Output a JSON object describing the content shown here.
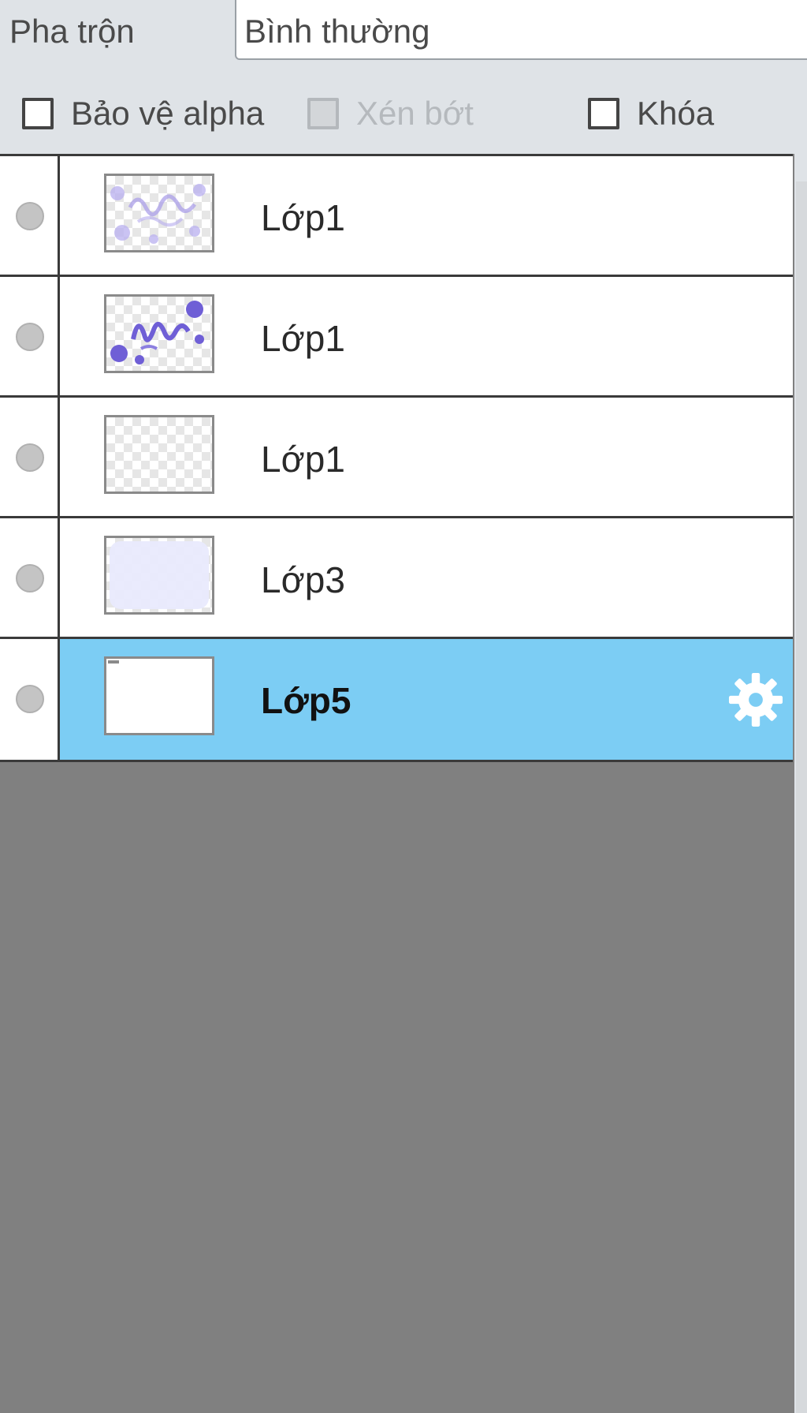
{
  "blend": {
    "label": "Pha trộn",
    "value": "Bình thường"
  },
  "options": {
    "alpha_protect": {
      "label": "Bảo vệ alpha",
      "checked": false,
      "enabled": true
    },
    "clipping": {
      "label": "Xén bớt",
      "checked": false,
      "enabled": false
    },
    "lock": {
      "label": "Khóa",
      "checked": false,
      "enabled": true
    }
  },
  "layers": [
    {
      "name": "Lớp1",
      "visible": false,
      "selected": false,
      "thumb": "faint-purple-sketch"
    },
    {
      "name": "Lớp1",
      "visible": false,
      "selected": false,
      "thumb": "purple-lettering-dots"
    },
    {
      "name": "Lớp1",
      "visible": false,
      "selected": false,
      "thumb": "empty-transparent"
    },
    {
      "name": "Lớp3",
      "visible": false,
      "selected": false,
      "thumb": "pale-lavender-fill"
    },
    {
      "name": "Lớp5",
      "visible": false,
      "selected": true,
      "thumb": "white-fill"
    }
  ],
  "colors": {
    "selected_row": "#7ccdf4",
    "empty_area": "#808080",
    "panel_bg": "#dfe3e7",
    "thumb_purple": "#7a6ad8"
  },
  "icons": {
    "visibility": "visibility-dot-icon",
    "layer_settings": "gear-icon"
  }
}
